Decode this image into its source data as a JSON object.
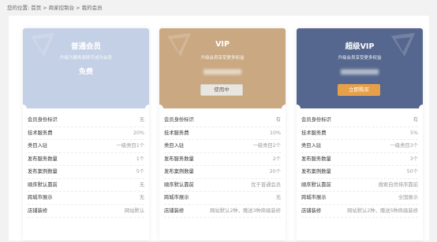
{
  "breadcrumb": {
    "prefix": "您的位置:",
    "items": [
      "首页",
      "商家控制台",
      "我的会员"
    ],
    "separator": ">"
  },
  "colors": {
    "card1": "#c4d0e6",
    "card2": "#c9a882",
    "card3": "#55678e",
    "button_buy": "#e7a04a"
  },
  "cards": [
    {
      "title": "普通会员",
      "subtitle": "升级为服务商即可成为会员",
      "price": "免费",
      "price_hidden": false,
      "button": "",
      "rows": [
        {
          "label": "会员身份标识",
          "value": "无"
        },
        {
          "label": "技术服务费",
          "value": "20%"
        },
        {
          "label": "类目入驻",
          "value": "一级类目1个"
        },
        {
          "label": "发布服务数量",
          "value": "1个"
        },
        {
          "label": "发布案例数量",
          "value": "5个"
        },
        {
          "label": "顺序默认靠前",
          "value": "无"
        },
        {
          "label": "跨城市展示",
          "value": "无"
        },
        {
          "label": "店铺装修",
          "value": "网站默认"
        }
      ]
    },
    {
      "title": "VIP",
      "subtitle": "升级会员享受更多权益",
      "price": "",
      "price_hidden": true,
      "button": "使用中",
      "rows": [
        {
          "label": "会员身份标识",
          "value": "有"
        },
        {
          "label": "技术服务费",
          "value": "10%"
        },
        {
          "label": "类目入驻",
          "value": "一级类目2个"
        },
        {
          "label": "发布服务数量",
          "value": "2个"
        },
        {
          "label": "发布案例数量",
          "value": "20个"
        },
        {
          "label": "顺序默认靠前",
          "value": "优于普通会员"
        },
        {
          "label": "跨城市展示",
          "value": "无"
        },
        {
          "label": "店铺装修",
          "value": "网站默认2种，赠送3种商级装修"
        }
      ]
    },
    {
      "title": "超级VIP",
      "subtitle": "升级会员享受更多权益",
      "price": "",
      "price_hidden": true,
      "button": "立即购买",
      "rows": [
        {
          "label": "会员身份标识",
          "value": "有"
        },
        {
          "label": "技术服务费",
          "value": "5%"
        },
        {
          "label": "类目入驻",
          "value": "一级类目3个"
        },
        {
          "label": "发布服务数量",
          "value": "3个"
        },
        {
          "label": "发布案例数量",
          "value": "50个"
        },
        {
          "label": "顺序默认靠前",
          "value": "搜索自然排序靠前"
        },
        {
          "label": "跨城市展示",
          "value": "全国展示"
        },
        {
          "label": "店铺装修",
          "value": "网站默认2种，赠送5种商级装修"
        }
      ]
    }
  ]
}
